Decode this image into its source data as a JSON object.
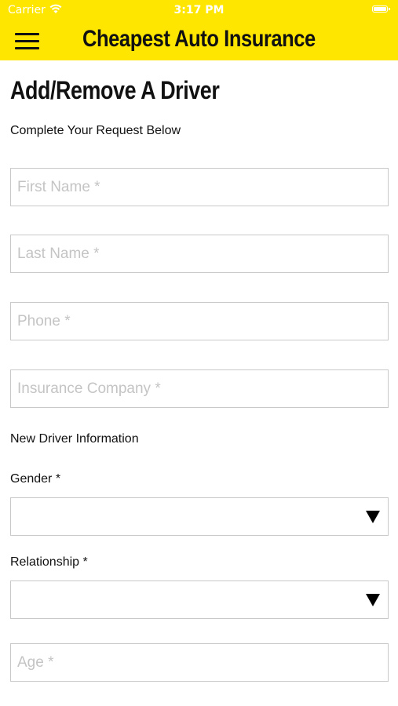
{
  "status_bar": {
    "carrier": "Carrier",
    "time": "3:17 PM"
  },
  "header": {
    "title": "Cheapest Auto Insurance",
    "menu_icon": "hamburger-menu-icon"
  },
  "page": {
    "title": "Add/Remove A Driver",
    "subtitle": "Complete Your Request Below"
  },
  "form": {
    "first_name": {
      "placeholder": "First Name *",
      "value": ""
    },
    "last_name": {
      "placeholder": "Last Name *",
      "value": ""
    },
    "phone": {
      "placeholder": "Phone *",
      "value": ""
    },
    "insurance_company": {
      "placeholder": "Insurance Company *",
      "value": ""
    },
    "new_driver_section": "New Driver Information",
    "gender": {
      "label": "Gender *",
      "value": ""
    },
    "relationship": {
      "label": "Relationship *",
      "value": ""
    },
    "age": {
      "placeholder": "Age *",
      "value": ""
    }
  },
  "colors": {
    "header_bg": "#ffe600",
    "text": "#111111",
    "border": "#c9c9c9",
    "placeholder": "#c4c4c4"
  }
}
